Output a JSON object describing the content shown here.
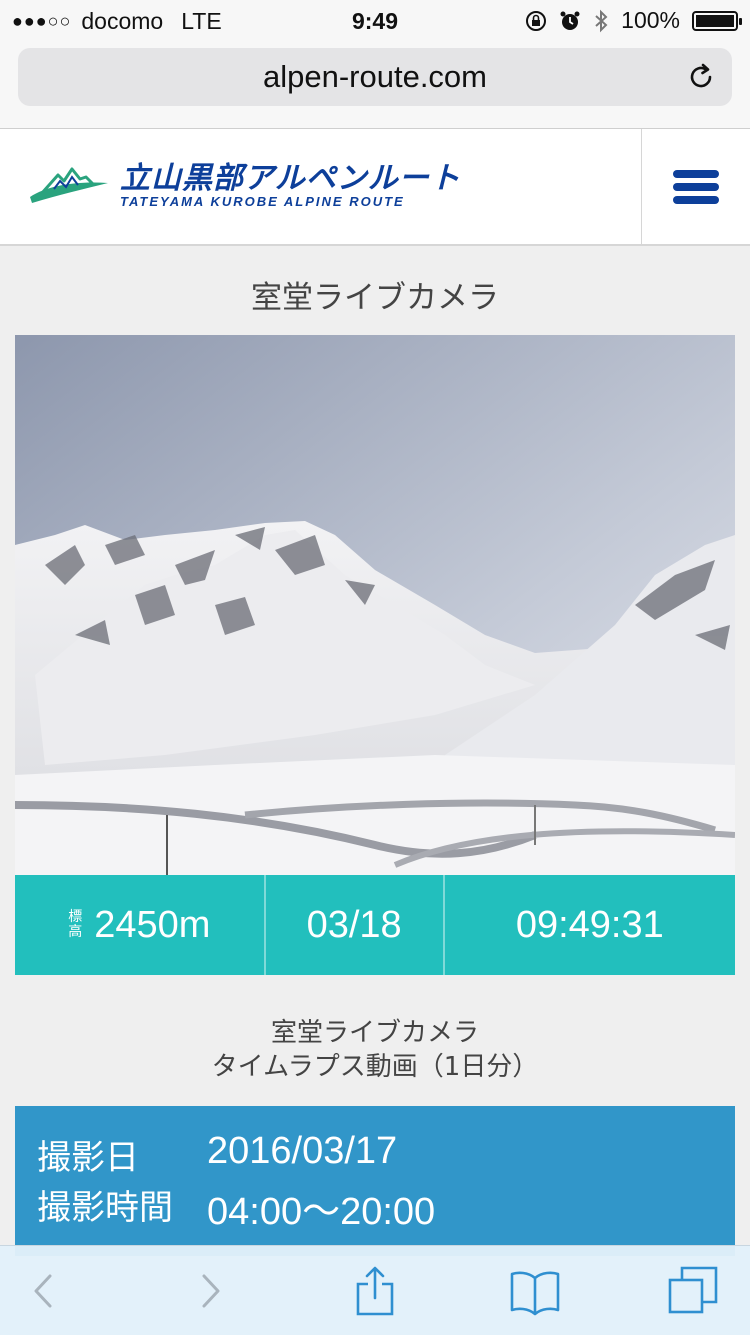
{
  "status_bar": {
    "signal": "●●●○○",
    "carrier": "docomo",
    "network": "LTE",
    "time": "9:49",
    "battery_text": "100%",
    "icons": [
      "orientation-lock-icon",
      "alarm-icon",
      "bluetooth-icon",
      "battery-icon"
    ]
  },
  "browser": {
    "url": "alpen-route.com"
  },
  "header": {
    "logo_jp": "立山黒部アルペンルート",
    "logo_en": "TATEYAMA KUROBE ALPINE ROUTE",
    "colors": {
      "brand": "#0d3f9a",
      "logo_green": "#2aa37e"
    }
  },
  "camera": {
    "title": "室堂ライブカメラ",
    "altitude_label": "標高",
    "altitude": "2450m",
    "date": "03/18",
    "time": "09:49:31",
    "bar_color": "#22bfbd"
  },
  "timelapse": {
    "title_line1": "室堂ライブカメラ",
    "title_line2": "タイムラプス動画（1日分）",
    "date_label": "撮影日",
    "date_value": "2016/03/17",
    "time_label": "撮影時間",
    "time_value": "04:00〜20:00",
    "box_color": "#3196c9"
  },
  "toolbar": {
    "icons": [
      "back-icon",
      "forward-icon",
      "share-icon",
      "bookmarks-icon",
      "tabs-icon"
    ]
  }
}
